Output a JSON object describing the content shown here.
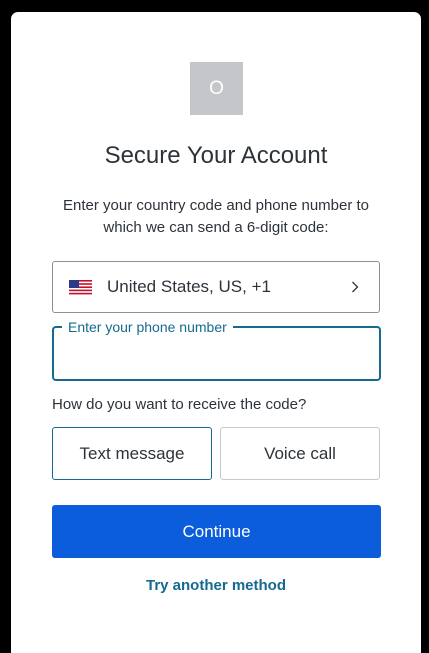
{
  "logo": {
    "letter": "O"
  },
  "title": "Secure Your Account",
  "subtitle": "Enter your country code and phone number to which we can send a 6-digit code:",
  "country": {
    "label": "United States, US, +1",
    "flag_icon": "us-flag-icon",
    "chevron_icon": "chevron-right-icon"
  },
  "phone": {
    "label": "Enter your phone number",
    "value": ""
  },
  "question": "How do you want to receive the code?",
  "options": {
    "text_message": "Text message",
    "voice_call": "Voice call",
    "selected": "text_message"
  },
  "continue_label": "Continue",
  "another_method_label": "Try another method",
  "colors": {
    "accent": "#166a8f",
    "primary_button": "#0b5ddb",
    "text": "#2d333a",
    "logo_bg": "#c4c6ca"
  }
}
